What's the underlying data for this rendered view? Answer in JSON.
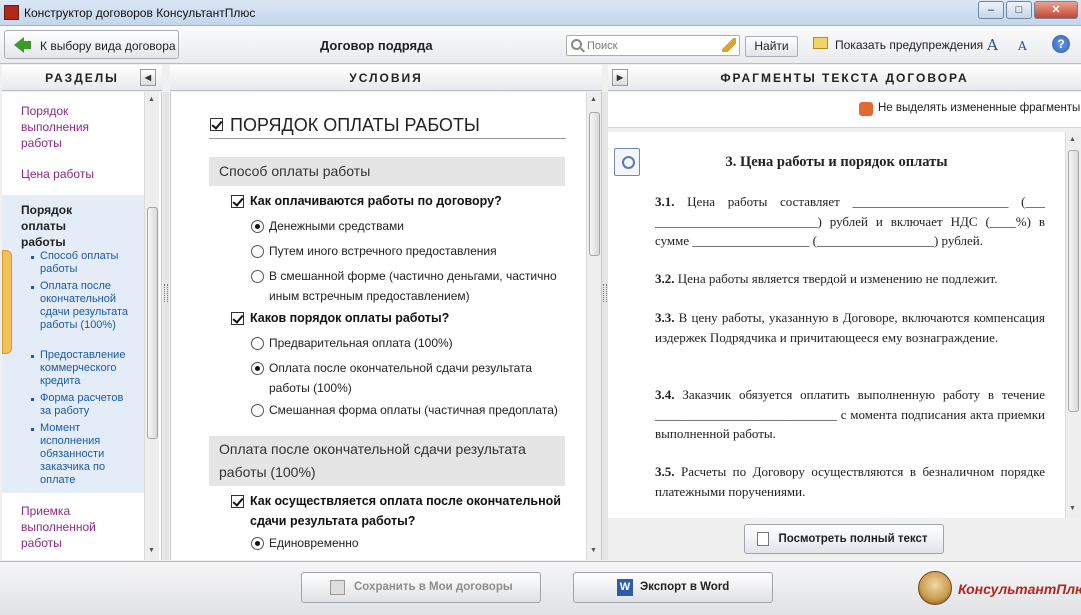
{
  "window": {
    "title": "Конструктор договоров КонсультантПлюс",
    "controls": {
      "minimize": "–",
      "maximize": "□",
      "close": "✕"
    }
  },
  "toolbar": {
    "back_label": "К выбору вида договора",
    "doc_title": "Договор подряда",
    "search_placeholder": "Поиск",
    "find_label": "Найти",
    "warnings_label": "Показать предупреждения",
    "font_up": "A",
    "font_down": "A",
    "help": "?"
  },
  "left": {
    "header": "РАЗДЕЛЫ",
    "collapse": "◀",
    "items": [
      "Порядок выполнения работы",
      "Цена работы",
      "Порядок оплаты работы",
      "Приемка выполненной работы"
    ],
    "subitems": [
      "Способ оплаты работы",
      "Оплата после окончательной сдачи результата работы (100%)",
      "Предоставление коммерческого кредита",
      "Форма расчетов за работу",
      "Момент исполнения обязанности заказчика по оплате"
    ]
  },
  "middle": {
    "header": "УСЛОВИЯ",
    "title": "ПОРЯДОК ОПЛАТЫ РАБОТЫ",
    "section1": "Способ оплаты работы",
    "q1": "Как оплачиваются работы по договору?",
    "q1_opts": [
      "Денежными средствами",
      "Путем иного встречного предоставления",
      "В смешанной форме (частично деньгами, частично иным встречным предоставлением)"
    ],
    "q2": "Каков порядок оплаты работы?",
    "q2_opts": [
      "Предварительная оплата (100%)",
      "Оплата после окончательной сдачи результата работы (100%)",
      "Смешанная форма оплаты (частичная предоплата)"
    ],
    "section2": "Оплата после окончательной сдачи результата работы (100%)",
    "q3": "Как осуществляется оплата после окончательной сдачи результата работы?",
    "q3_opts": [
      "Единовременно"
    ]
  },
  "right": {
    "header": "ФРАГМЕНТЫ ТЕКСТА ДОГОВОРА",
    "expand": "▶",
    "no_highlight": "Не выделять измененные фрагменты",
    "doc_heading": "3. Цена работы и порядок оплаты",
    "paragraphs": [
      {
        "num": "3.1.",
        "text": " Цена работы составляет ________________________ (___ _________________________) рублей и включает НДС (____%) в сумме __________________ (__________________) рублей."
      },
      {
        "num": "3.2.",
        "text": " Цена работы является твердой и изменению не подлежит."
      },
      {
        "num": "3.3.",
        "text": " В цену работы, указанную в Договоре, включаются компенсация издержек Подрядчика и причитающееся ему вознаграждение."
      },
      {
        "num": "3.4.",
        "text": " Заказчик обязуется оплатить выполненную работу в течение ____________________________ с момента подписания акта приемки выполненной работы."
      },
      {
        "num": "3.5.",
        "text": " Расчеты по Договору осуществляются в безналичном порядке платежными поручениями."
      }
    ],
    "view_full_label": "Посмотреть полный текст"
  },
  "bottom": {
    "save_label": "Сохранить в Мои договоры",
    "export_label": "Экспорт в Word",
    "word_icon_letter": "W",
    "logo_text": "КонсультантПлюс"
  },
  "icons": {
    "back": "green-arrow-left-icon",
    "search": "magnifier-icon",
    "clear": "broom-icon",
    "warnings": "speech-bubble-icon",
    "font_up": "font-increase-icon",
    "font_down": "font-decrease-icon",
    "help": "help-icon",
    "view_doc": "document-magnifier-icon"
  },
  "colors": {
    "section_link": "#8b2a86",
    "subsection_link": "#1a5aa8",
    "active_section_bg": "#e4ecf8",
    "logo_red": "#b3261e",
    "tab_accent": "#f4c05a"
  }
}
